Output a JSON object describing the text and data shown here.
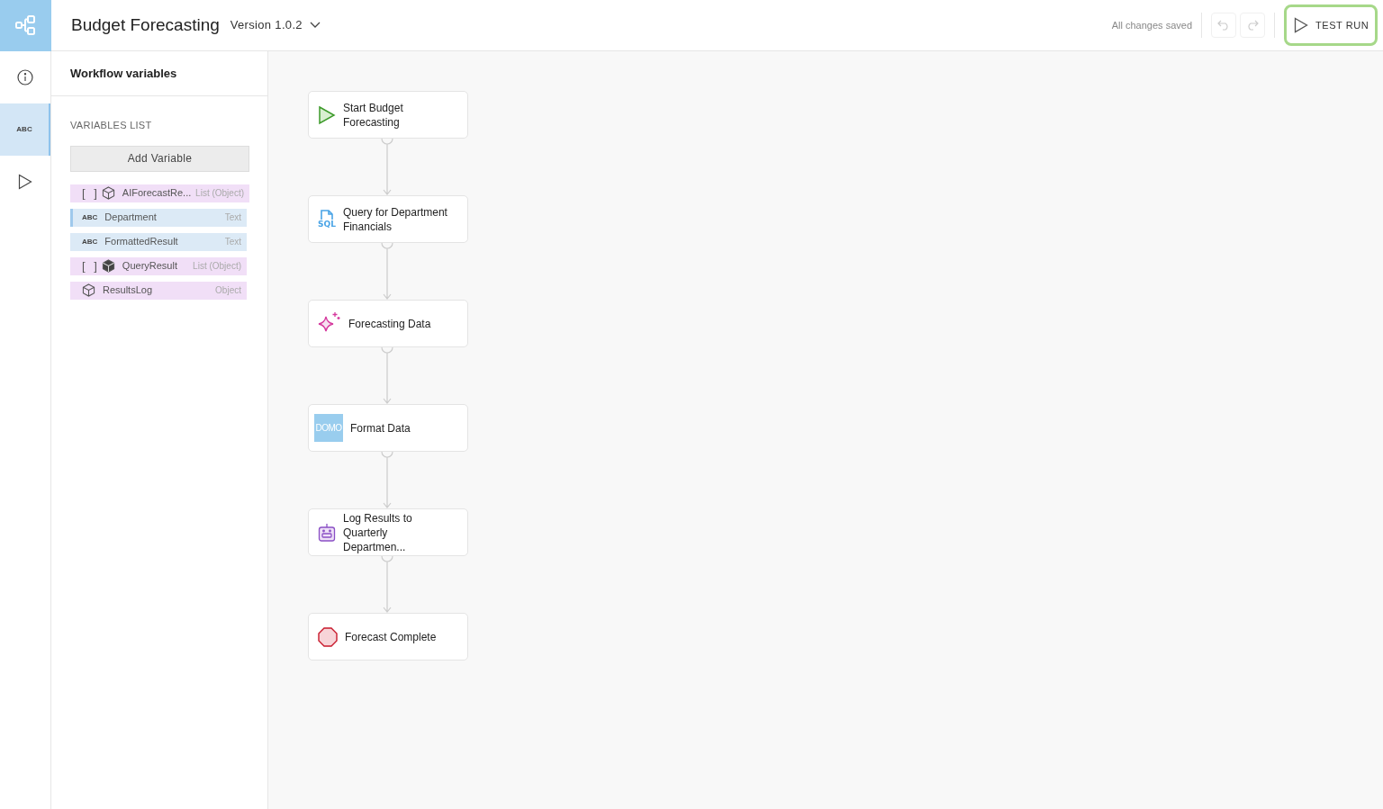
{
  "header": {
    "title": "Budget Forecasting",
    "version": "Version 1.0.2",
    "save_status": "All changes saved",
    "test_run_label": "TEST RUN"
  },
  "rail": {
    "items": [
      {
        "kind": "info",
        "selected": false
      },
      {
        "kind": "variables",
        "label": "ABC",
        "selected": true
      },
      {
        "kind": "run",
        "selected": false
      }
    ]
  },
  "panel": {
    "title": "Workflow variables",
    "section": "VARIABLES LIST",
    "add_button": "Add Variable",
    "variables": [
      {
        "kind": "list-object",
        "badge": "[ ]",
        "name": "AIForecastRe...",
        "type": "List (Object)",
        "selected": false
      },
      {
        "kind": "text",
        "badge": "ABC",
        "name": "Department",
        "type": "Text",
        "selected": true
      },
      {
        "kind": "text",
        "badge": "ABC",
        "name": "FormattedResult",
        "type": "Text",
        "selected": false
      },
      {
        "kind": "list-object-filled",
        "badge": "[ ]",
        "name": "QueryResult",
        "type": "List (Object)",
        "selected": false
      },
      {
        "kind": "object",
        "name": "ResultsLog",
        "type": "Object",
        "selected": false
      }
    ]
  },
  "nodes": [
    {
      "kind": "start",
      "label": "Start Budget Forecasting"
    },
    {
      "kind": "sql",
      "label": "Query for Department Financials",
      "icon_text": "SQL"
    },
    {
      "kind": "ai",
      "label": "Forecasting Data"
    },
    {
      "kind": "logo",
      "label": "Format Data",
      "logo_text": "DOMO"
    },
    {
      "kind": "bot",
      "label": "Log Results to Quarterly Departmen..."
    },
    {
      "kind": "end",
      "label": "Forecast Complete"
    }
  ]
}
